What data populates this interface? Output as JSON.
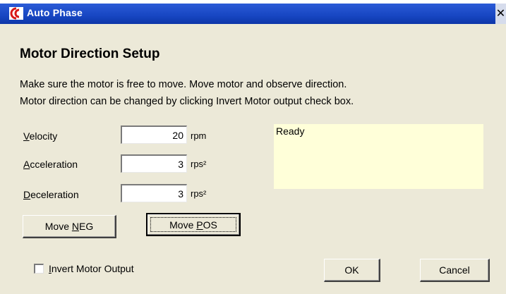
{
  "window": {
    "title": "Auto Phase",
    "close_glyph": "✕",
    "icon": "app-logo-icon"
  },
  "heading": "Motor Direction Setup",
  "description": {
    "line1": "Make sure the motor is free to move.  Move motor and observe direction.",
    "line2": "Motor direction can be changed by clicking Invert Motor output check box."
  },
  "fields": {
    "velocity": {
      "label_key": "V",
      "label_rest": "elocity",
      "value": "20",
      "unit": "rpm"
    },
    "acceleration": {
      "label_key": "A",
      "label_rest": "cceleration",
      "value": "3",
      "unit": "rps²"
    },
    "deceleration": {
      "label_key": "D",
      "label_rest": "eceleration",
      "value": "3",
      "unit": "rps²"
    }
  },
  "status": {
    "text": "Ready",
    "background": "#ffffd9"
  },
  "buttons": {
    "move_neg_pre": "Move ",
    "move_neg_key": "N",
    "move_neg_post": "EG",
    "move_pos_pre": "Move ",
    "move_pos_key": "P",
    "move_pos_post": "OS",
    "ok": "OK",
    "cancel": "Cancel"
  },
  "invert": {
    "checked": false,
    "label_key": "I",
    "label_rest": "nvert Motor Output"
  },
  "colors": {
    "title_bar": "#1746c2",
    "dialog_bg": "#ece9d8"
  }
}
